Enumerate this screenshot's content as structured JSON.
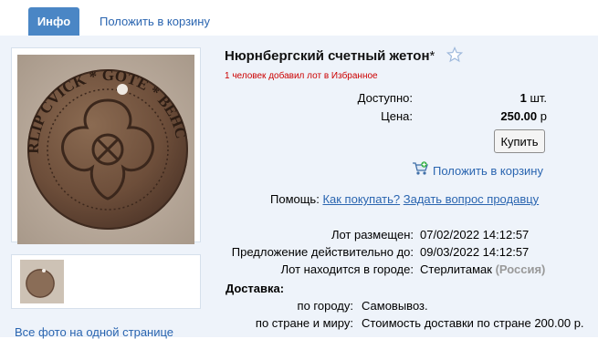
{
  "tabs": {
    "info": "Инфо",
    "add_to_cart": "Положить в корзину"
  },
  "lot": {
    "title": "Нюрнбергский счетный жетон",
    "title_asterisk": "*",
    "favorites_note": "1 человек добавил лот в Избранное",
    "available_label": "Доступно:",
    "available_value": "1",
    "available_unit": "шт.",
    "price_label": "Цена:",
    "price_value": "250.00",
    "price_currency": "р",
    "buy_button": "Купить",
    "cart_link": "Положить в корзину"
  },
  "help": {
    "label": "Помощь:",
    "how_to_buy": "Как покупать?",
    "ask_seller": "Задать вопрос продавцу"
  },
  "details": {
    "placed_label": "Лот размещен:",
    "placed_value": "07/02/2022 14:12:57",
    "valid_until_label": "Предложение действительно до:",
    "valid_until_value": "09/03/2022 14:12:57",
    "city_label": "Лот находится в городе:",
    "city_value": "Стерлитамак",
    "country_value": "(Россия)"
  },
  "delivery": {
    "heading": "Доставка:",
    "city_label": "по городу:",
    "city_value": "Самовывоз.",
    "country_label": "по стране и миру:",
    "country_value": "Стоимость доставки по стране 200.00 р."
  },
  "gallery": {
    "all_photos_link": "Все фото на одной странице",
    "coin_inscription": "HERLIP CVICK * GOTE * BEHC"
  },
  "icons": {
    "star": "star-outline-icon",
    "cart": "cart-add-icon"
  },
  "colors": {
    "tab_active_bg": "#4a86c5",
    "link": "#2a65b0",
    "panel_bg": "#eef3fa",
    "favorites_note": "#cc0000"
  }
}
